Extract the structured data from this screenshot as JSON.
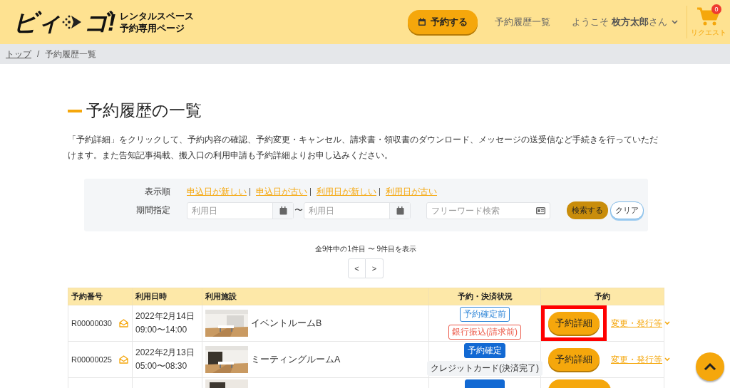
{
  "header": {
    "logo": {
      "left": "ビィ",
      "right": "ゴ!"
    },
    "tagline": [
      "レンタルスペース",
      "予約専用ページ"
    ],
    "reserve_button": "予約する",
    "history_link": "予約履歴一覧",
    "user_menu": "ようこそ **枚方太郎**さん",
    "cart": {
      "count": "0",
      "label": "リクエスト"
    }
  },
  "breadcrumb": [
    {
      "label": "トップ",
      "link": true
    },
    {
      "label": "予約履歴一覧",
      "link": false
    }
  ],
  "breadcrumb_separator": "/",
  "title": "予約履歴の一覧",
  "intro": "「予約詳細」をクリックして、予約内容の確認、予約変更・キャンセル、請求書・領収書のダウンロード、メッセージの送受信など手続きを行っていただけます。また告知記事掲載、搬入口の利用申請も予約詳細よりお申し込みください。",
  "filter": {
    "sort_label": "表示順",
    "sort_options": [
      {
        "label": "申込日が新しい"
      },
      {
        "label": "申込日が古い"
      },
      {
        "label": "利用日が新しい"
      },
      {
        "label": "利用日が古い"
      }
    ],
    "period_label": "期間指定",
    "date_from": {
      "placeholder": "利用日"
    },
    "range_sep": "〜",
    "date_to": {
      "placeholder": "利用日"
    },
    "keyword": {
      "placeholder": "フリーワード検索"
    },
    "search_button": "検索する",
    "clear_button": "クリア"
  },
  "result_count": "全9件中の1件目 〜 9件目を表示",
  "pager": {
    "prev": "<",
    "next": ">"
  },
  "table": {
    "columns": [
      "予約番号",
      "利用日時",
      "利用施設",
      "予約・決済状況",
      "予約"
    ],
    "rows": [
      {
        "id": "R00000030",
        "date": "2022年2月14日",
        "time": "09:00〜14:00",
        "facility": "イベントルームB",
        "statuses": [
          {
            "text": "予約確定前",
            "kind": "outline-blue"
          },
          {
            "text": "銀行振込(請求前)",
            "kind": "outline-red"
          }
        ],
        "detail_button": "予約詳細",
        "menu_link": "変更・発行等",
        "highlighted": true
      },
      {
        "id": "R00000025",
        "date": "2022年2月13日",
        "time": "05:00〜08:30",
        "facility": "ミーティングルームA",
        "statuses": [
          {
            "text": "予約確定",
            "kind": "solid-blue"
          },
          {
            "text": "クレジットカード(決済完了)",
            "kind": "plain-grey"
          }
        ],
        "detail_button": "予約詳細",
        "menu_link": "変更・発行等",
        "highlighted": false
      }
    ]
  }
}
